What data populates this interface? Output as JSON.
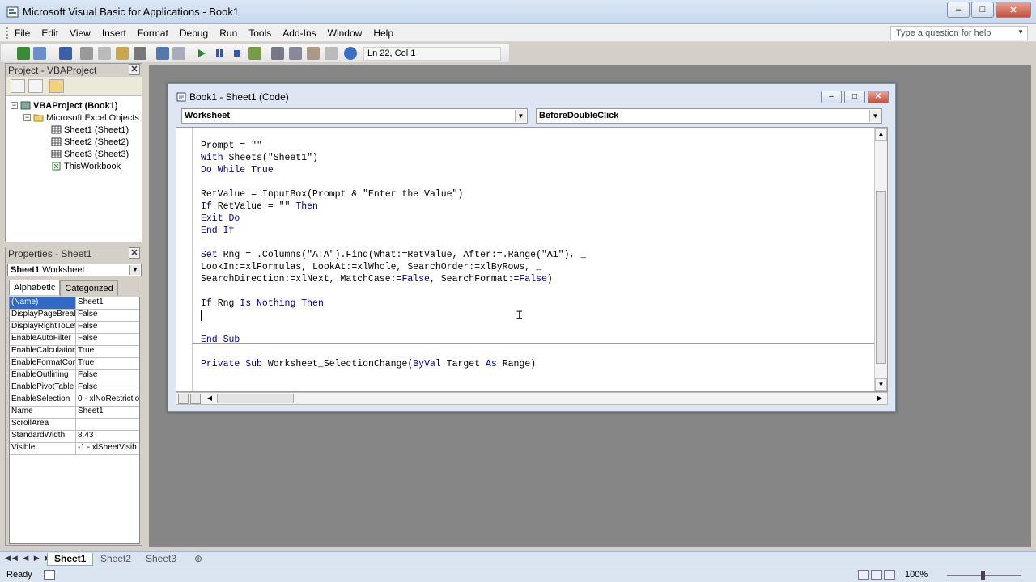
{
  "window": {
    "title": "Microsoft Visual Basic for Applications - Book1",
    "minimize": "–",
    "restore": "□",
    "close": "✕"
  },
  "menu": {
    "items": [
      "File",
      "Edit",
      "View",
      "Insert",
      "Format",
      "Debug",
      "Run",
      "Tools",
      "Add-Ins",
      "Window",
      "Help"
    ]
  },
  "help_search": {
    "placeholder": "Type a question for help"
  },
  "toolbar": {
    "position": "Ln 22, Col 1"
  },
  "project_explorer": {
    "title": "Project - VBAProject",
    "close": "✕",
    "root": "VBAProject (Book1)",
    "folder": "Microsoft Excel Objects",
    "items": [
      "Sheet1 (Sheet1)",
      "Sheet2 (Sheet2)",
      "Sheet3 (Sheet3)",
      "ThisWorkbook"
    ]
  },
  "properties": {
    "title": "Properties - Sheet1",
    "close": "✕",
    "object_name": "Sheet1",
    "object_type": "Worksheet",
    "tabs": [
      "Alphabetic",
      "Categorized"
    ],
    "rows": [
      {
        "k": "(Name)",
        "v": "Sheet1"
      },
      {
        "k": "DisplayPageBreak",
        "v": "False"
      },
      {
        "k": "DisplayRightToLef",
        "v": "False"
      },
      {
        "k": "EnableAutoFilter",
        "v": "False"
      },
      {
        "k": "EnableCalculation",
        "v": "True"
      },
      {
        "k": "EnableFormatCon",
        "v": "True"
      },
      {
        "k": "EnableOutlining",
        "v": "False"
      },
      {
        "k": "EnablePivotTable",
        "v": "False"
      },
      {
        "k": "EnableSelection",
        "v": "0 - xlNoRestrictio"
      },
      {
        "k": "Name",
        "v": "Sheet1"
      },
      {
        "k": "ScrollArea",
        "v": ""
      },
      {
        "k": "StandardWidth",
        "v": "8.43"
      },
      {
        "k": "Visible",
        "v": "-1 - xlSheetVisib"
      }
    ]
  },
  "code_window": {
    "title": "Book1 - Sheet1 (Code)",
    "object_combo": "Worksheet",
    "procedure_combo": "BeforeDoubleClick",
    "lines": [
      [
        {
          "t": "Prompt = \"\"",
          "c": "txt"
        }
      ],
      [
        {
          "t": "With",
          "c": "kw"
        },
        {
          "t": " Sheets(\"Sheet1\")",
          "c": "txt"
        }
      ],
      [
        {
          "t": "Do While True",
          "c": "kw"
        }
      ],
      [],
      [
        {
          "t": "RetValue = InputBox(Prompt & \"Enter the Value\")",
          "c": "txt"
        }
      ],
      [
        {
          "t": "If",
          "c": "kw"
        },
        {
          "t": " RetValue = \"\" ",
          "c": "txt"
        },
        {
          "t": "Then",
          "c": "kw"
        }
      ],
      [
        {
          "t": "Exit Do",
          "c": "kw"
        }
      ],
      [
        {
          "t": "End If",
          "c": "kw"
        }
      ],
      [],
      [
        {
          "t": "Set",
          "c": "kw"
        },
        {
          "t": " Rng = .Columns(\"A:A\").Find(What:=RetValue, After:=.Range(\"A1\"), _",
          "c": "txt"
        }
      ],
      [
        {
          "t": "LookIn:=xlFormulas, LookAt:=xlWhole, SearchOrder:=xlByRows, _",
          "c": "txt"
        }
      ],
      [
        {
          "t": "SearchDirection:=xlNext, MatchCase:=",
          "c": "txt"
        },
        {
          "t": "False",
          "c": "kw"
        },
        {
          "t": ", SearchFormat:=",
          "c": "txt"
        },
        {
          "t": "False",
          "c": "kw"
        },
        {
          "t": ")",
          "c": "txt"
        }
      ],
      [],
      [
        {
          "t": "If",
          "c": "kw"
        },
        {
          "t": " Rng ",
          "c": "txt"
        },
        {
          "t": "Is Nothing Then",
          "c": "kw"
        }
      ],
      [],
      [],
      [
        {
          "t": "End Sub",
          "c": "kw"
        }
      ],
      [],
      [
        {
          "t": "Private Sub",
          "c": "kw"
        },
        {
          "t": " Worksheet_SelectionChange(",
          "c": "txt"
        },
        {
          "t": "ByVal",
          "c": "kw"
        },
        {
          "t": " Target ",
          "c": "txt"
        },
        {
          "t": "As",
          "c": "kw"
        },
        {
          "t": " Range)",
          "c": "txt"
        }
      ]
    ]
  },
  "sheet_tabs": [
    "Sheet1",
    "Sheet2",
    "Sheet3"
  ],
  "status": {
    "ready": "Ready",
    "zoom": "100%"
  },
  "colors": {
    "keyword": "#00008b",
    "selection": "#316ac5",
    "mdi_background": "#868686"
  }
}
